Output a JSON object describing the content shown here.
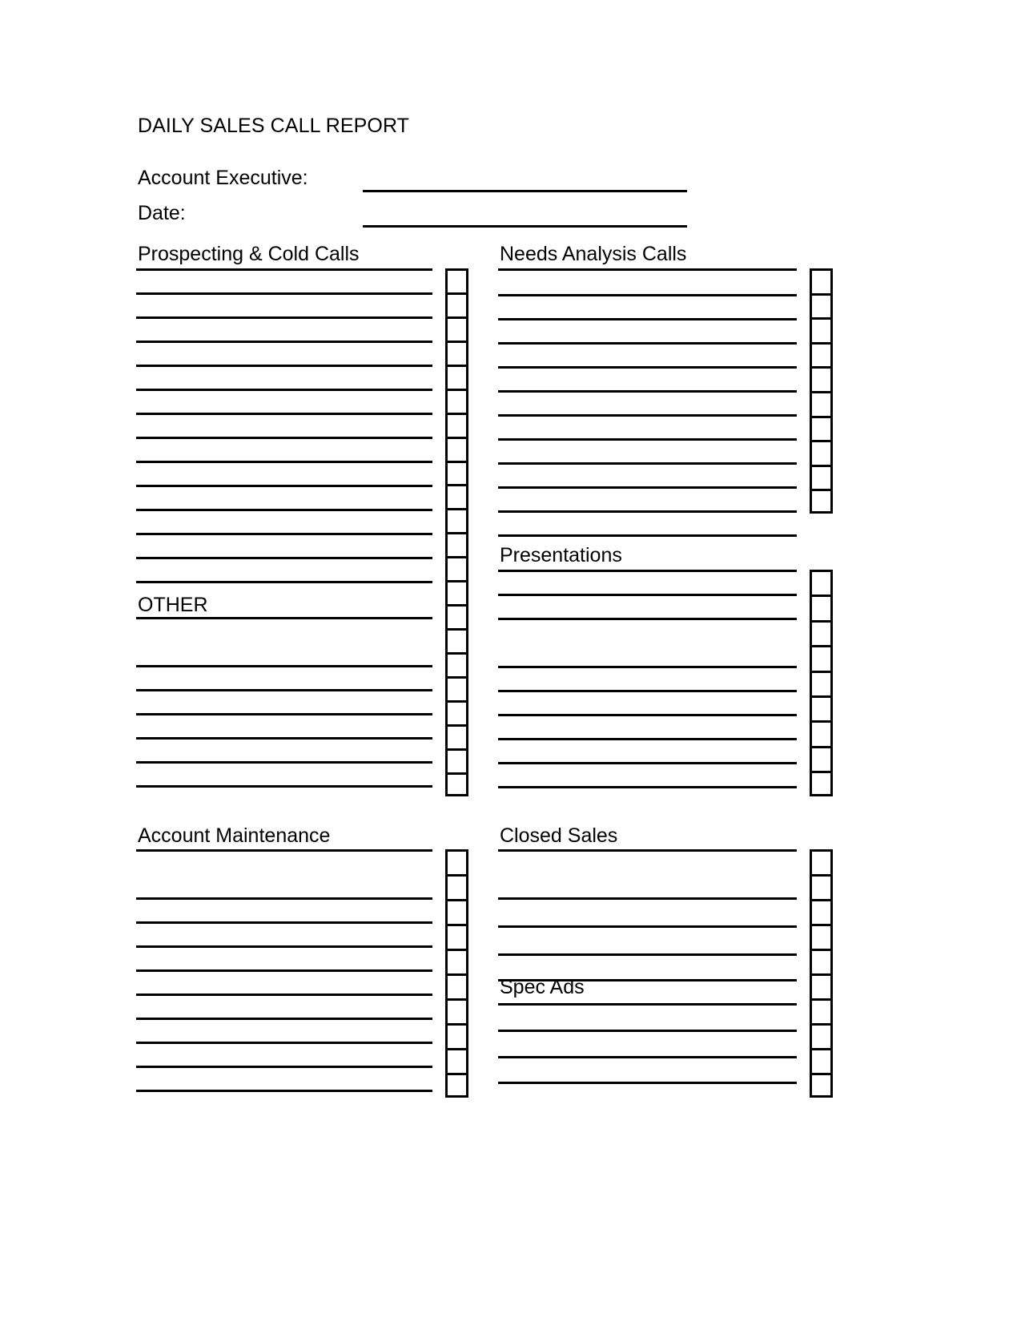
{
  "document": {
    "title": "DAILY SALES CALL REPORT"
  },
  "fields": [
    {
      "label": "Account Executive:",
      "value": ""
    },
    {
      "label": "Date:",
      "value": ""
    }
  ],
  "sections": [
    {
      "id": "prospecting-cold-calls",
      "heading": "Prospecting & Cold Calls",
      "column": "left"
    },
    {
      "id": "other",
      "heading": "OTHER",
      "column": "left"
    },
    {
      "id": "account-maintenance",
      "heading": "Account Maintenance",
      "column": "left"
    },
    {
      "id": "needs-analysis-calls",
      "heading": "Needs Analysis Calls",
      "column": "right"
    },
    {
      "id": "presentations",
      "heading": "Presentations",
      "column": "right"
    },
    {
      "id": "closed-sales",
      "heading": "Closed Sales",
      "column": "right"
    },
    {
      "id": "spec-ads",
      "heading": "Spec Ads",
      "column": "right"
    }
  ],
  "colors": {
    "ink": "#000000",
    "paper": "#ffffff"
  }
}
